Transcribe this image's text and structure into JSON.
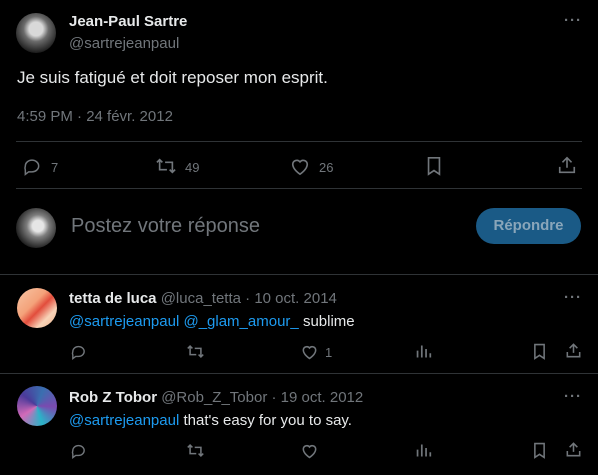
{
  "main_tweet": {
    "author_name": "Jean-Paul Sartre",
    "author_handle": "@sartrejeanpaul",
    "text": "Je suis fatigué et doit reposer mon esprit.",
    "timestamp": "4:59 PM · 24 févr. 2012",
    "replies": "7",
    "retweets": "49",
    "likes": "26"
  },
  "composer": {
    "placeholder": "Postez votre réponse",
    "button_label": "Répondre"
  },
  "replies": [
    {
      "author_name": "tetta de luca",
      "author_handle": "@luca_tetta",
      "date": "· 10 oct. 2014",
      "mention1": "@sartrejeanpaul",
      "mention2": "@_glam_amour_",
      "text": "sublime",
      "likes": "1"
    },
    {
      "author_name": "Rob Z Tobor",
      "author_handle": "@Rob_Z_Tobor",
      "date": "· 19 oct. 2012",
      "mention1": "@sartrejeanpaul",
      "text": "that's easy for you to say."
    }
  ],
  "colors": {
    "background": "#000000",
    "text": "#e7e9ea",
    "muted": "#71767b",
    "link": "#1d9bf0",
    "divider": "#2f3336",
    "button_bg": "#1a5a86"
  },
  "icons": [
    "more-icon",
    "reply-icon",
    "retweet-icon",
    "like-icon",
    "bookmark-icon",
    "share-icon",
    "views-icon"
  ]
}
